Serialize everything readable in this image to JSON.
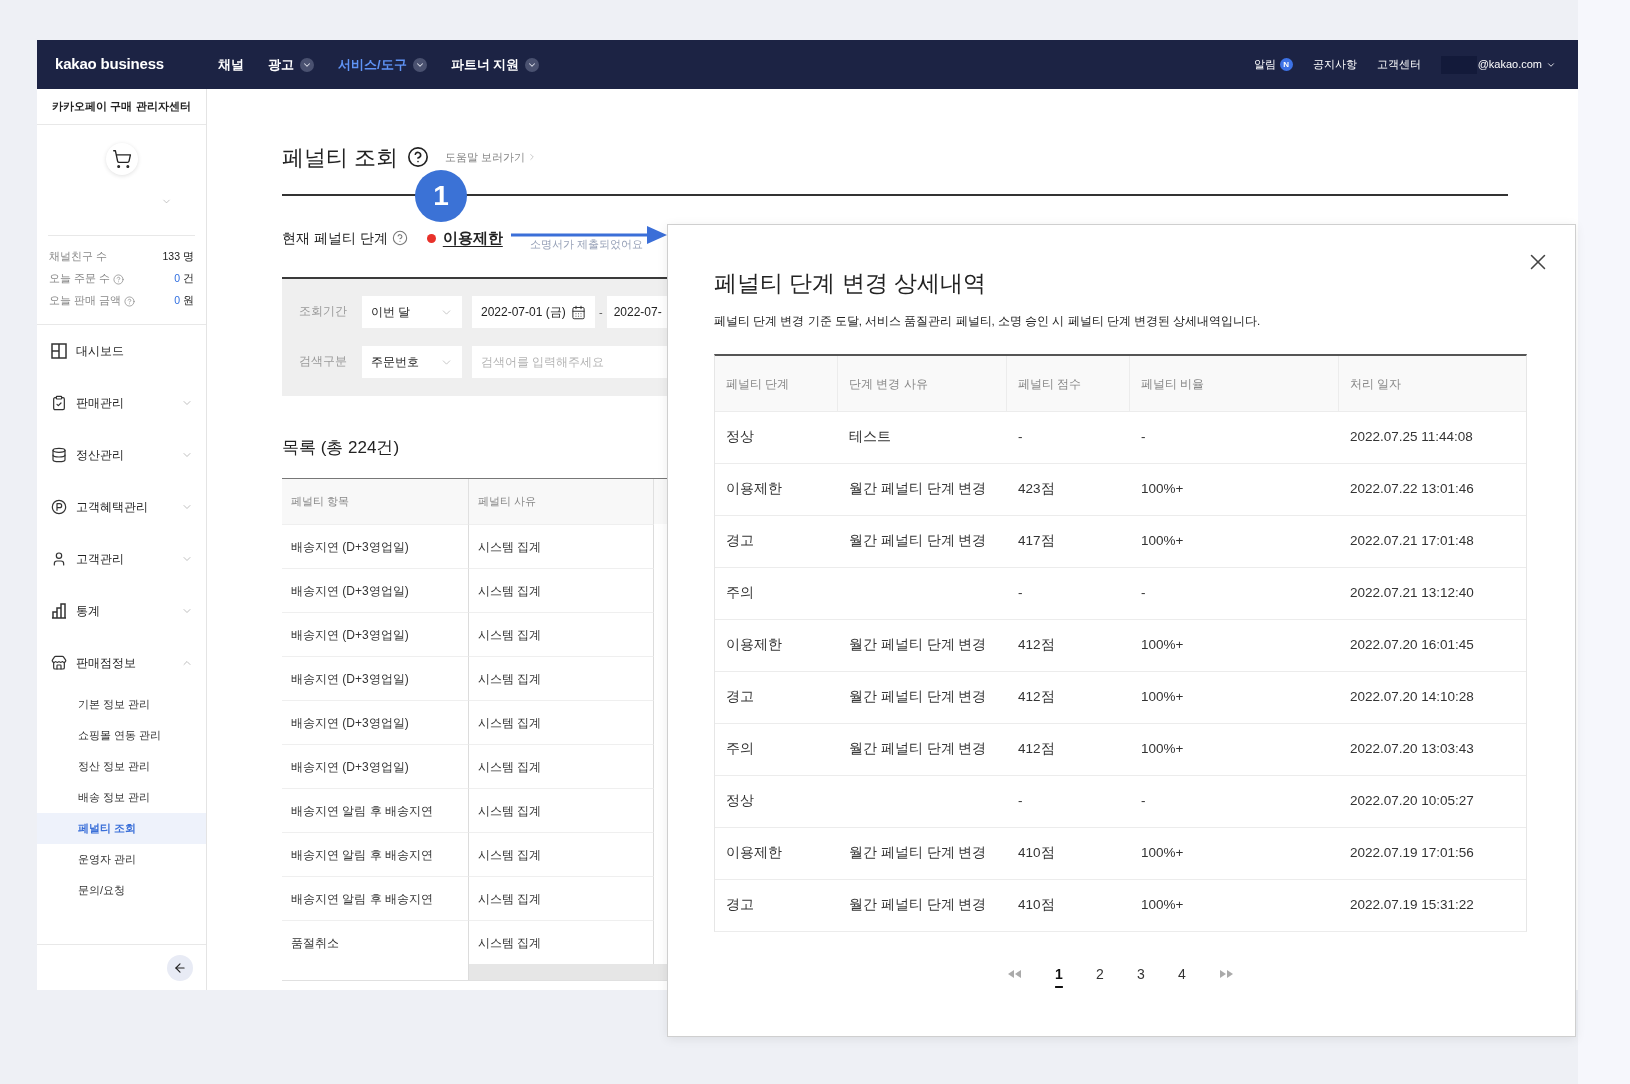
{
  "nav": {
    "logo": "kakao business",
    "menu": [
      {
        "label": "채널",
        "selected": false,
        "dropdown": false
      },
      {
        "label": "광고",
        "selected": false,
        "dropdown": true
      },
      {
        "label": "서비스/도구",
        "selected": true,
        "dropdown": true
      },
      {
        "label": "파트너 지원",
        "selected": false,
        "dropdown": true
      }
    ],
    "alert": {
      "label": "알림",
      "badge": "N"
    },
    "links": [
      "공지사항",
      "고객센터"
    ],
    "account": {
      "email": "@kakao.com"
    }
  },
  "sidebar": {
    "title": "카카오페이 구매 관리자센터",
    "stats": [
      {
        "label": "채널친구 수",
        "help": false,
        "value": "133",
        "unit": "명",
        "linked": false
      },
      {
        "label": "오늘 주문 수",
        "help": true,
        "value": "0",
        "unit": "건",
        "linked": true
      },
      {
        "label": "오늘 판매 금액",
        "help": true,
        "value": "0",
        "unit": "원",
        "linked": true
      }
    ],
    "menu": [
      {
        "label": "대시보드"
      },
      {
        "label": "판매관리",
        "expanded": false
      },
      {
        "label": "정산관리",
        "expanded": false
      },
      {
        "label": "고객혜택관리",
        "expanded": false
      },
      {
        "label": "고객관리",
        "expanded": false
      },
      {
        "label": "통계",
        "expanded": false
      },
      {
        "label": "판매점정보",
        "expanded": true,
        "children": [
          {
            "label": "기본 정보 관리",
            "selected": false
          },
          {
            "label": "쇼핑몰 연동 관리",
            "selected": false
          },
          {
            "label": "정산 정보 관리",
            "selected": false
          },
          {
            "label": "배송 정보 관리",
            "selected": false
          },
          {
            "label": "페널티 조회",
            "selected": true
          },
          {
            "label": "운영자 관리",
            "selected": false
          },
          {
            "label": "문의/요청",
            "selected": false
          }
        ]
      }
    ]
  },
  "page": {
    "title": "페널티 조회",
    "help_link": "도움말 보러가기",
    "current_stage": {
      "label": "현재 페널티 단계",
      "value": "이용제한",
      "note": "소명서가 제출되었어요"
    },
    "filters": [
      {
        "kind": "date_range",
        "label": "조회기간",
        "select": "이번 달",
        "from": "2022-07-01 (금)",
        "separator": "-",
        "to": "2022-07-"
      },
      {
        "kind": "search",
        "label": "검색구분",
        "select": "주문번호",
        "placeholder": "검색어를 입력해주세요"
      }
    ],
    "list": {
      "title": "목록 (총 224건)",
      "columns": [
        "페널티 항목",
        "페널티 사유"
      ],
      "rows": [
        [
          "배송지연 (D+3영업일)",
          "시스템 집계"
        ],
        [
          "배송지연 (D+3영업일)",
          "시스템 집계"
        ],
        [
          "배송지연 (D+3영업일)",
          "시스템 집계"
        ],
        [
          "배송지연 (D+3영업일)",
          "시스템 집계"
        ],
        [
          "배송지연 (D+3영업일)",
          "시스템 집계"
        ],
        [
          "배송지연 (D+3영업일)",
          "시스템 집계"
        ],
        [
          "배송지연 알림 후 배송지연",
          "시스템 집계"
        ],
        [
          "배송지연 알림 후 배송지연",
          "시스템 집계"
        ],
        [
          "배송지연 알림 후 배송지연",
          "시스템 집계"
        ],
        [
          "품절취소",
          "시스템 집계"
        ]
      ]
    }
  },
  "annotation": {
    "step": "1"
  },
  "modal": {
    "title": "페널티 단계 변경 상세내역",
    "description": "페널티 단계 변경 기준 도달, 서비스 품질관리 페널티, 소명 승인 시 페널티 단계 변경된 상세내역입니다.",
    "columns": [
      "페널티 단계",
      "단계 변경 사유",
      "페널티 점수",
      "페널티 비율",
      "처리 일자"
    ],
    "rows": [
      [
        "정상",
        "테스트",
        "-",
        "-",
        "2022.07.25 11:44:08"
      ],
      [
        "이용제한",
        "월간 페널티 단계 변경",
        "423점",
        "100%+",
        "2022.07.22 13:01:46"
      ],
      [
        "경고",
        "월간 페널티 단계 변경",
        "417점",
        "100%+",
        "2022.07.21 17:01:48"
      ],
      [
        "주의",
        null,
        "-",
        "-",
        "2022.07.21 13:12:40"
      ],
      [
        "이용제한",
        "월간 페널티 단계 변경",
        "412점",
        "100%+",
        "2022.07.20 16:01:45"
      ],
      [
        "경고",
        "월간 페널티 단계 변경",
        "412점",
        "100%+",
        "2022.07.20 14:10:28"
      ],
      [
        "주의",
        "월간 페널티 단계 변경",
        "412점",
        "100%+",
        "2022.07.20 13:03:43"
      ],
      [
        "정상",
        null,
        "-",
        "-",
        "2022.07.20 10:05:27"
      ],
      [
        "이용제한",
        "월간 페널티 단계 변경",
        "410점",
        "100%+",
        "2022.07.19 17:01:56"
      ],
      [
        "경고",
        "월간 페널티 단계 변경",
        "410점",
        "100%+",
        "2022.07.19 15:31:22"
      ]
    ],
    "pagination": [
      {
        "label": "1",
        "selected": true
      },
      {
        "label": "2",
        "selected": false
      },
      {
        "label": "3",
        "selected": false
      },
      {
        "label": "4",
        "selected": false
      }
    ]
  }
}
